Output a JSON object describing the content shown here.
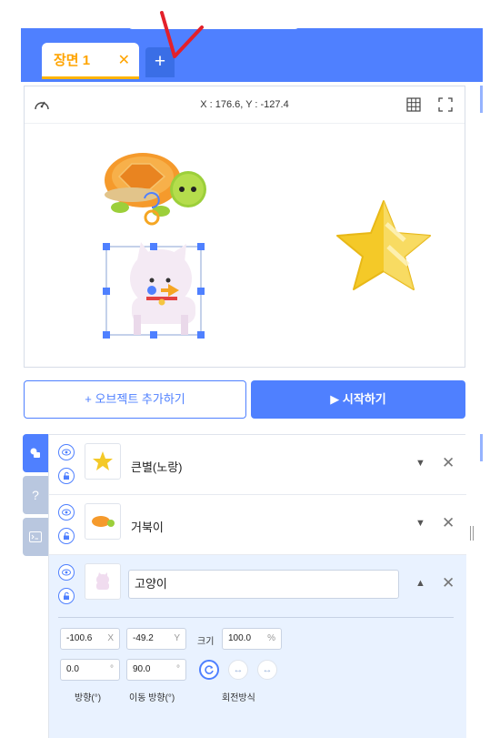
{
  "scene_tabs": {
    "active_label": "장면 1",
    "close_symbol": "✕",
    "add_symbol": "+"
  },
  "stage": {
    "coordinates": "X : 176.6, Y : -127.4",
    "icons": [
      "speed-gauge-icon",
      "grid-icon",
      "fullscreen-icon"
    ],
    "sprites": [
      "turtle",
      "cat",
      "star"
    ]
  },
  "buttons": {
    "add_object": "+ 오브젝트 추가하기",
    "start": "▶ 시작하기"
  },
  "side_tabs": {
    "object_icon": "object-tab-icon",
    "help_label": "?",
    "console_icon": "console-icon"
  },
  "objects": [
    {
      "name": "큰별(노랑)",
      "expanded": false,
      "arrow": "▼",
      "close": "✕"
    },
    {
      "name": "거북이",
      "expanded": false,
      "arrow": "▼",
      "close": "✕"
    },
    {
      "name": "고양이",
      "expanded": true,
      "arrow": "▲",
      "close": "✕"
    }
  ],
  "properties": {
    "x_value": "-100.6",
    "x_unit": "X",
    "y_value": "-49.2",
    "y_unit": "Y",
    "size_label": "크기",
    "size_value": "100.0",
    "size_unit": "%",
    "direction_value": "0.0",
    "direction_unit": "°",
    "move_direction_value": "90.0",
    "move_direction_unit": "°",
    "direction_label": "방향(°)",
    "move_direction_label": "이동 방향(°)",
    "rotation_label": "회전방식"
  },
  "colors": {
    "accent": "#4f80ff",
    "tab_highlight": "#ffa400",
    "selected_row": "#e9f2ff"
  }
}
